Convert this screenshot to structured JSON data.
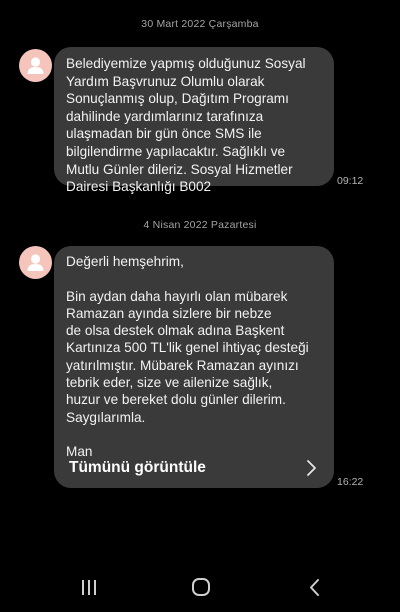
{
  "conversation": {
    "messages": [
      {
        "date_separator": "30 Mart 2022 Çarşamba",
        "text": "Belediyemize yapmış olduğunuz Sosyal\nYardım Başvrunuz Olumlu olarak\nSonuçlanmış olup, Dağıtım Programı\ndahilinde yardımlarınız tarafınıza\nulaşmadan bir gün önce SMS ile\nbilgilendirme yapılacaktır. Sağlıklı ve\nMutlu Günler dileriz. Sosyal Hizmetler\nDairesi Başkanlığı B002",
        "time": "09:12"
      },
      {
        "date_separator": "4 Nisan 2022 Pazartesi",
        "text": "Değerli hemşehrim,\n\nBin aydan daha hayırlı olan mübarek\nRamazan ayında sizlere bir nebze\nde olsa destek olmak adına Başkent\nKartınıza 500 TL'lik genel ihtiyaç desteği\nyatırılmıştır. Mübarek Ramazan ayınızı\ntebrik eder, size ve ailenize sağlık,\nhuzur ve bereket dolu günler dilerim.\nSaygılarımla.\n\nMan",
        "view_all_label": "Tümünü görüntüle",
        "time": "16:22"
      }
    ]
  },
  "icons": {
    "avatar": "person-icon",
    "view_all": "chevron-right-icon",
    "nav_recent": "recent-apps-icon",
    "nav_home": "home-icon",
    "nav_back": "back-icon"
  },
  "colors": {
    "background": "#000000",
    "bubble": "#3a3a3a",
    "avatar": "#f5c5bc",
    "avatar_figure": "#ffffff",
    "secondary_text": "#a4a4a4"
  }
}
